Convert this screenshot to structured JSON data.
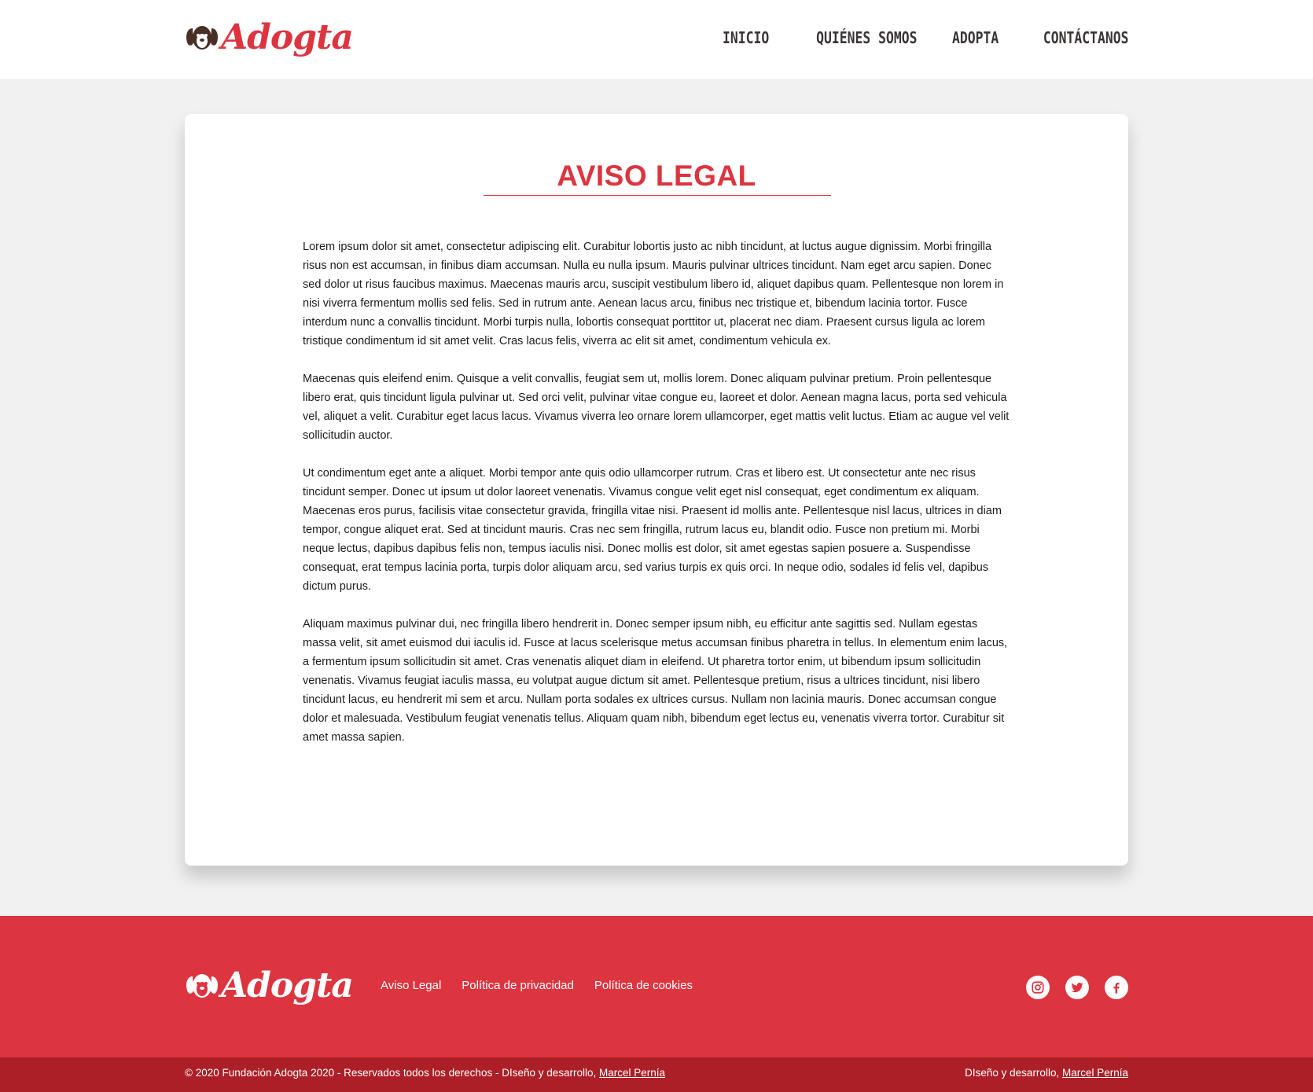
{
  "brand": {
    "name": "Adogta",
    "primary_color": "#dc3540",
    "dark_red": "#ac1f27",
    "icon": "dog-face-icon"
  },
  "nav": {
    "items": [
      {
        "label": "INICIO"
      },
      {
        "label": "QUIÉNES SOMOS"
      },
      {
        "label": "ADOPTA"
      },
      {
        "label": "CONTÁCTANOS"
      }
    ]
  },
  "page": {
    "title": "AVISO LEGAL",
    "paragraphs": [
      "Lorem ipsum dolor sit amet, consectetur adipiscing elit. Curabitur lobortis justo ac nibh tincidunt, at luctus augue dignissim. Morbi fringilla risus non est accumsan, in finibus diam accumsan. Nulla eu nulla ipsum. Mauris pulvinar ultrices tincidunt. Nam eget arcu sapien. Donec sed dolor ut risus faucibus maximus. Maecenas mauris arcu, suscipit vestibulum libero id, aliquet dapibus quam. Pellentesque non lorem in nisi viverra fermentum mollis sed felis. Sed in rutrum ante. Aenean lacus arcu, finibus nec tristique et, bibendum lacinia tortor. Fusce interdum nunc a convallis tincidunt. Morbi turpis nulla, lobortis consequat porttitor ut, placerat nec diam. Praesent cursus ligula ac lorem tristique condimentum id sit amet velit. Cras lacus felis, viverra ac elit sit amet, condimentum vehicula ex.",
      "Maecenas quis eleifend enim. Quisque a velit convallis, feugiat sem ut, mollis lorem. Donec aliquam pulvinar pretium. Proin pellentesque libero erat, quis tincidunt ligula pulvinar ut. Sed orci velit, pulvinar vitae congue eu, laoreet et dolor. Aenean magna lacus, porta sed vehicula vel, aliquet a velit. Curabitur eget lacus lacus. Vivamus viverra leo ornare lorem ullamcorper, eget mattis velit luctus. Etiam ac augue vel velit sollicitudin auctor.",
      "Ut condimentum eget ante a aliquet. Morbi tempor ante quis odio ullamcorper rutrum. Cras et libero est. Ut consectetur ante nec risus tincidunt semper. Donec ut ipsum ut dolor laoreet venenatis. Vivamus congue velit eget nisl consequat, eget condimentum ex aliquam. Maecenas eros purus, facilisis vitae consectetur gravida, fringilla vitae nisi. Praesent id mollis ante. Pellentesque nisl lacus, ultrices in diam tempor, congue aliquet erat. Sed at tincidunt mauris. Cras nec sem fringilla, rutrum lacus eu, blandit odio. Fusce non pretium mi. Morbi neque lectus, dapibus dapibus felis non, tempus iaculis nisi. Donec mollis est dolor, sit amet egestas sapien posuere a. Suspendisse consequat, erat tempus lacinia porta, turpis dolor aliquam arcu, sed varius turpis ex quis orci. In neque odio, sodales id felis vel, dapibus dictum purus.",
      "Aliquam maximus pulvinar dui, nec fringilla libero hendrerit in. Donec semper ipsum nibh, eu efficitur ante sagittis sed. Nullam egestas massa velit, sit amet euismod dui iaculis id. Fusce at lacus scelerisque metus accumsan finibus pharetra in tellus. In elementum enim lacus, a fermentum ipsum sollicitudin sit amet. Cras venenatis aliquet diam in eleifend. Ut pharetra tortor enim, ut bibendum ipsum sollicitudin venenatis. Vivamus feugiat iaculis massa, eu volutpat augue dictum sit amet. Pellentesque pretium, risus a ultrices tincidunt, nisi libero tincidunt lacus, eu hendrerit mi sem et arcu. Nullam porta sodales ex ultrices cursus. Nullam non lacinia mauris. Donec accumsan congue dolor et malesuada. Vestibulum feugiat venenatis tellus. Aliquam quam nibh, bibendum eget lectus eu, venenatis viverra tortor. Curabitur sit amet massa sapien."
    ]
  },
  "footer": {
    "links": [
      {
        "label": "Aviso Legal"
      },
      {
        "label": "Política de privacidad"
      },
      {
        "label": "Política de cookies"
      }
    ],
    "social": [
      {
        "icon": "instagram-icon"
      },
      {
        "icon": "twitter-icon"
      },
      {
        "icon": "facebook-icon"
      }
    ],
    "copyright_text": "© 2020 Fundación Adogta 2020 - Reservados todos los derechos - DIseño y desarrollo, ",
    "designer_link": "Marcel Pernía",
    "credit_right_text": "DIseño y desarrollo, ",
    "credit_right_link": "Marcel Pernía"
  }
}
